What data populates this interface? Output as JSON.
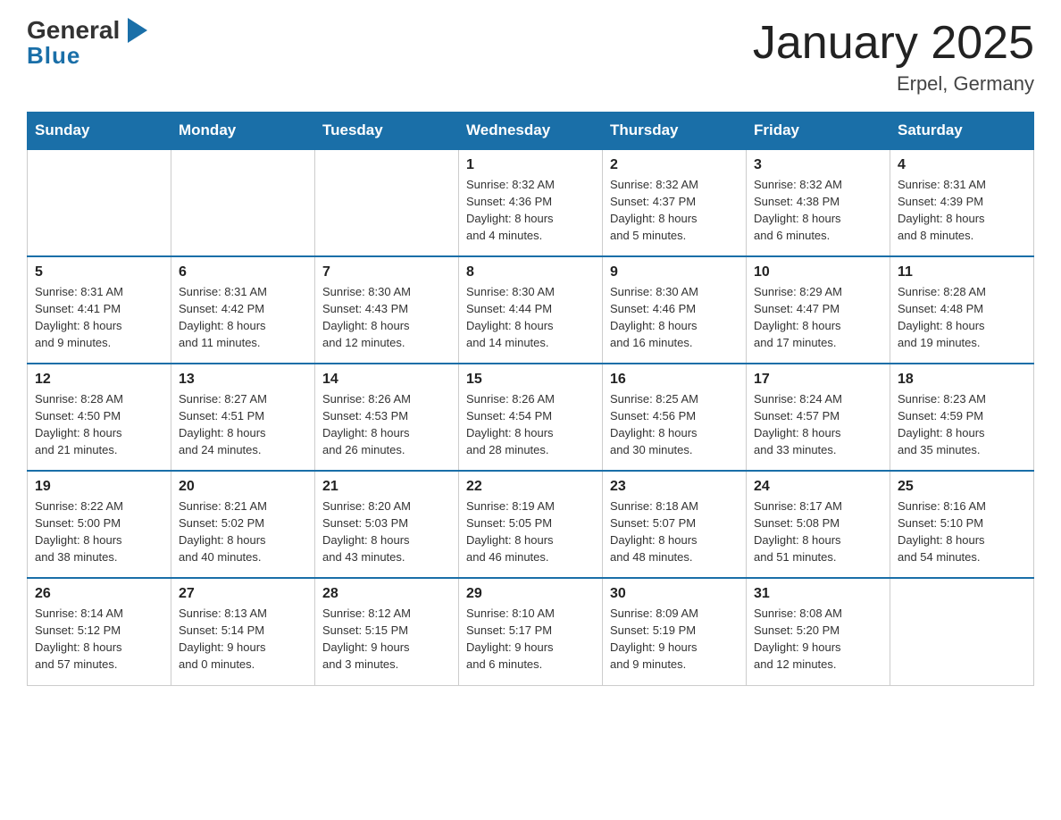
{
  "logo": {
    "line1_general": "General",
    "line1_arrow": "▶",
    "line2_blue": "Blue"
  },
  "title": "January 2025",
  "subtitle": "Erpel, Germany",
  "days_of_week": [
    "Sunday",
    "Monday",
    "Tuesday",
    "Wednesday",
    "Thursday",
    "Friday",
    "Saturday"
  ],
  "weeks": [
    [
      {
        "day": "",
        "info": ""
      },
      {
        "day": "",
        "info": ""
      },
      {
        "day": "",
        "info": ""
      },
      {
        "day": "1",
        "info": "Sunrise: 8:32 AM\nSunset: 4:36 PM\nDaylight: 8 hours\nand 4 minutes."
      },
      {
        "day": "2",
        "info": "Sunrise: 8:32 AM\nSunset: 4:37 PM\nDaylight: 8 hours\nand 5 minutes."
      },
      {
        "day": "3",
        "info": "Sunrise: 8:32 AM\nSunset: 4:38 PM\nDaylight: 8 hours\nand 6 minutes."
      },
      {
        "day": "4",
        "info": "Sunrise: 8:31 AM\nSunset: 4:39 PM\nDaylight: 8 hours\nand 8 minutes."
      }
    ],
    [
      {
        "day": "5",
        "info": "Sunrise: 8:31 AM\nSunset: 4:41 PM\nDaylight: 8 hours\nand 9 minutes."
      },
      {
        "day": "6",
        "info": "Sunrise: 8:31 AM\nSunset: 4:42 PM\nDaylight: 8 hours\nand 11 minutes."
      },
      {
        "day": "7",
        "info": "Sunrise: 8:30 AM\nSunset: 4:43 PM\nDaylight: 8 hours\nand 12 minutes."
      },
      {
        "day": "8",
        "info": "Sunrise: 8:30 AM\nSunset: 4:44 PM\nDaylight: 8 hours\nand 14 minutes."
      },
      {
        "day": "9",
        "info": "Sunrise: 8:30 AM\nSunset: 4:46 PM\nDaylight: 8 hours\nand 16 minutes."
      },
      {
        "day": "10",
        "info": "Sunrise: 8:29 AM\nSunset: 4:47 PM\nDaylight: 8 hours\nand 17 minutes."
      },
      {
        "day": "11",
        "info": "Sunrise: 8:28 AM\nSunset: 4:48 PM\nDaylight: 8 hours\nand 19 minutes."
      }
    ],
    [
      {
        "day": "12",
        "info": "Sunrise: 8:28 AM\nSunset: 4:50 PM\nDaylight: 8 hours\nand 21 minutes."
      },
      {
        "day": "13",
        "info": "Sunrise: 8:27 AM\nSunset: 4:51 PM\nDaylight: 8 hours\nand 24 minutes."
      },
      {
        "day": "14",
        "info": "Sunrise: 8:26 AM\nSunset: 4:53 PM\nDaylight: 8 hours\nand 26 minutes."
      },
      {
        "day": "15",
        "info": "Sunrise: 8:26 AM\nSunset: 4:54 PM\nDaylight: 8 hours\nand 28 minutes."
      },
      {
        "day": "16",
        "info": "Sunrise: 8:25 AM\nSunset: 4:56 PM\nDaylight: 8 hours\nand 30 minutes."
      },
      {
        "day": "17",
        "info": "Sunrise: 8:24 AM\nSunset: 4:57 PM\nDaylight: 8 hours\nand 33 minutes."
      },
      {
        "day": "18",
        "info": "Sunrise: 8:23 AM\nSunset: 4:59 PM\nDaylight: 8 hours\nand 35 minutes."
      }
    ],
    [
      {
        "day": "19",
        "info": "Sunrise: 8:22 AM\nSunset: 5:00 PM\nDaylight: 8 hours\nand 38 minutes."
      },
      {
        "day": "20",
        "info": "Sunrise: 8:21 AM\nSunset: 5:02 PM\nDaylight: 8 hours\nand 40 minutes."
      },
      {
        "day": "21",
        "info": "Sunrise: 8:20 AM\nSunset: 5:03 PM\nDaylight: 8 hours\nand 43 minutes."
      },
      {
        "day": "22",
        "info": "Sunrise: 8:19 AM\nSunset: 5:05 PM\nDaylight: 8 hours\nand 46 minutes."
      },
      {
        "day": "23",
        "info": "Sunrise: 8:18 AM\nSunset: 5:07 PM\nDaylight: 8 hours\nand 48 minutes."
      },
      {
        "day": "24",
        "info": "Sunrise: 8:17 AM\nSunset: 5:08 PM\nDaylight: 8 hours\nand 51 minutes."
      },
      {
        "day": "25",
        "info": "Sunrise: 8:16 AM\nSunset: 5:10 PM\nDaylight: 8 hours\nand 54 minutes."
      }
    ],
    [
      {
        "day": "26",
        "info": "Sunrise: 8:14 AM\nSunset: 5:12 PM\nDaylight: 8 hours\nand 57 minutes."
      },
      {
        "day": "27",
        "info": "Sunrise: 8:13 AM\nSunset: 5:14 PM\nDaylight: 9 hours\nand 0 minutes."
      },
      {
        "day": "28",
        "info": "Sunrise: 8:12 AM\nSunset: 5:15 PM\nDaylight: 9 hours\nand 3 minutes."
      },
      {
        "day": "29",
        "info": "Sunrise: 8:10 AM\nSunset: 5:17 PM\nDaylight: 9 hours\nand 6 minutes."
      },
      {
        "day": "30",
        "info": "Sunrise: 8:09 AM\nSunset: 5:19 PM\nDaylight: 9 hours\nand 9 minutes."
      },
      {
        "day": "31",
        "info": "Sunrise: 8:08 AM\nSunset: 5:20 PM\nDaylight: 9 hours\nand 12 minutes."
      },
      {
        "day": "",
        "info": ""
      }
    ]
  ]
}
